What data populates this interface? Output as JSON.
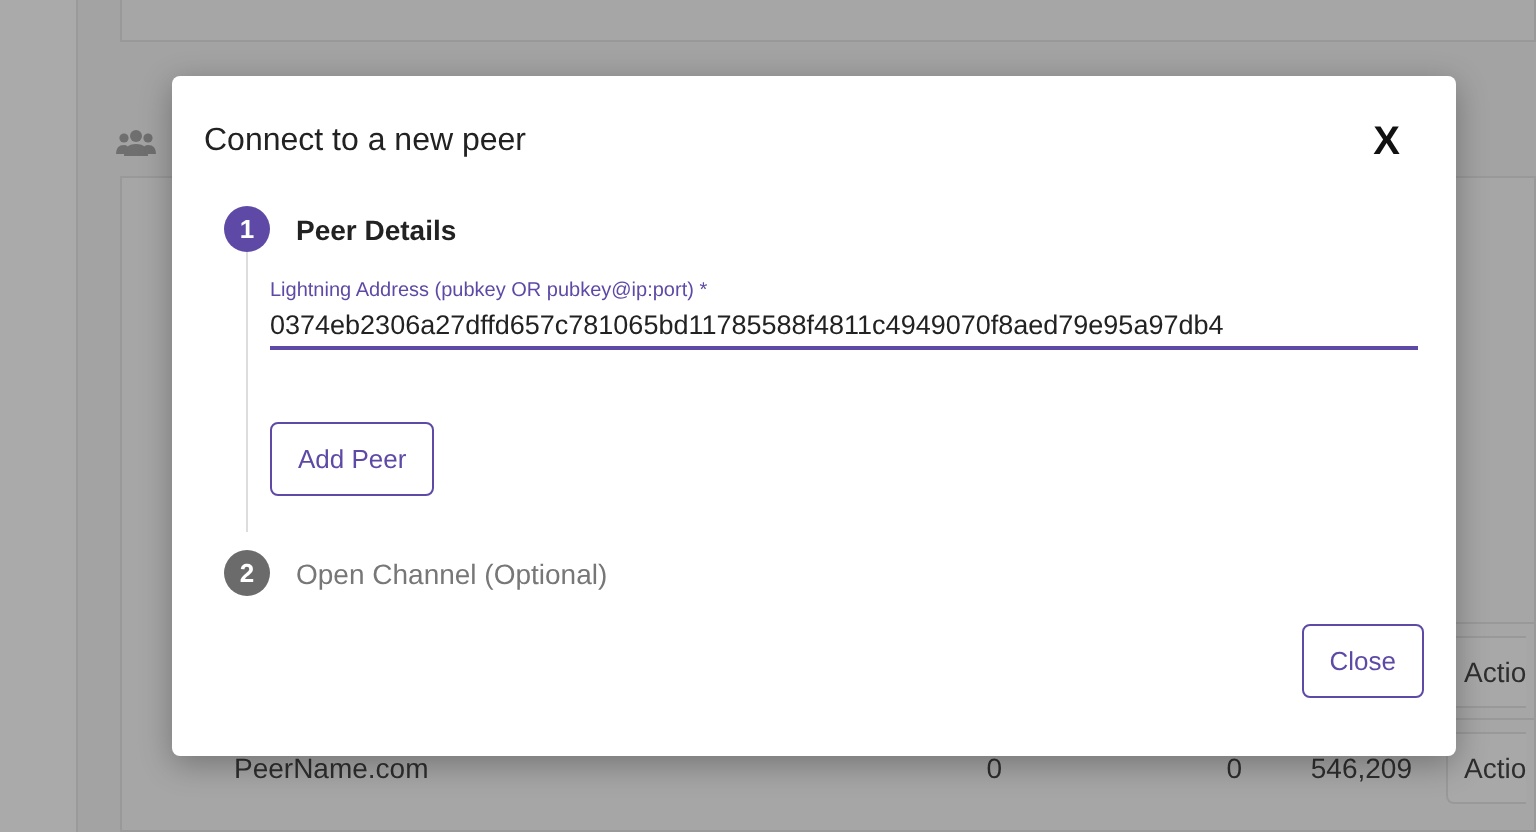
{
  "background": {
    "rows": [
      {
        "name": "",
        "col_2": "",
        "col_3": "",
        "col_4": "",
        "action": "Actio"
      },
      {
        "name": "PeerName.com",
        "col_2": "0",
        "col_3": "0",
        "col_4": "546,209",
        "action": "Actio"
      }
    ]
  },
  "dialog": {
    "title": "Connect to a new peer",
    "close_label": "X",
    "steps": [
      {
        "number": "1",
        "label": "Peer Details",
        "active": true
      },
      {
        "number": "2",
        "label": "Open Channel (Optional)",
        "active": false
      }
    ],
    "field": {
      "label": "Lightning Address (pubkey OR pubkey@ip:port)",
      "required_mark": "*",
      "value": "0374eb2306a27dffd657c781065bd11785588f4811c4949070f8aed79e95a97db4"
    },
    "add_button": "Add Peer",
    "close_button": "Close"
  }
}
